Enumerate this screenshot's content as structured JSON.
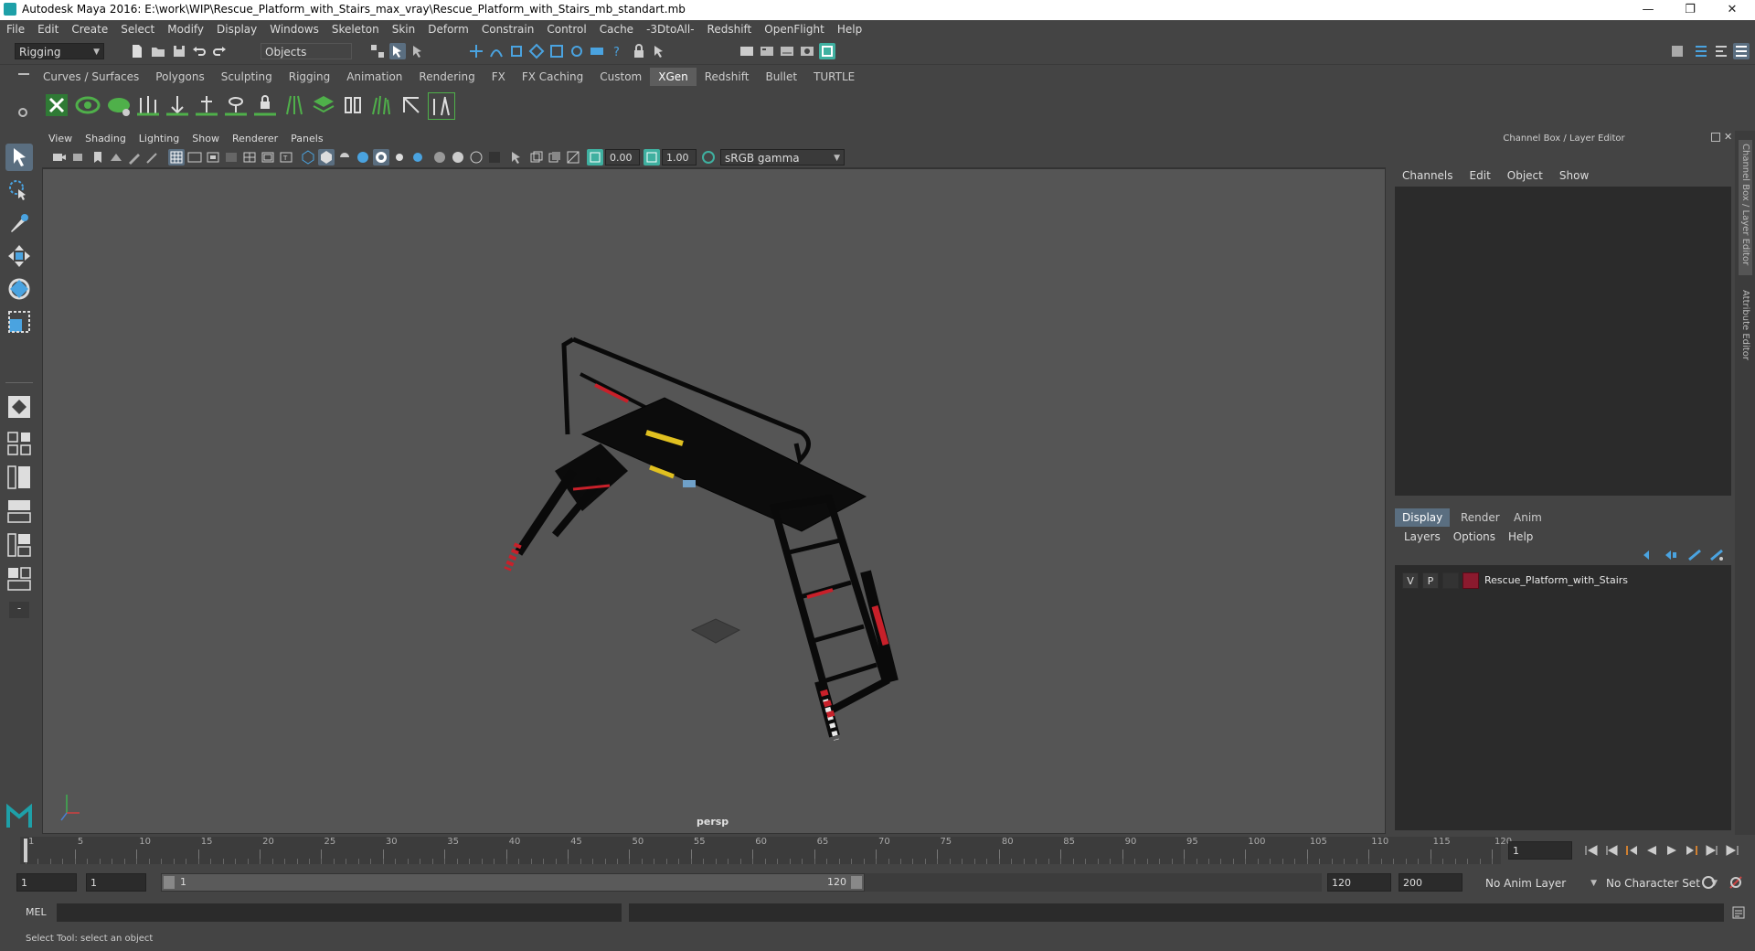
{
  "window": {
    "title": "Autodesk Maya 2016: E:\\work\\WIP\\Rescue_Platform_with_Stairs_max_vray\\Rescue_Platform_with_Stairs_mb_standart.mb",
    "minimize": "—",
    "maximize": "❐",
    "close": "✕"
  },
  "menubar": [
    "File",
    "Edit",
    "Create",
    "Select",
    "Modify",
    "Display",
    "Windows",
    "Skeleton",
    "Skin",
    "Deform",
    "Constrain",
    "Control",
    "Cache",
    "-3DtoAll-",
    "Redshift",
    "OpenFlight",
    "Help"
  ],
  "statusline": {
    "menuset": "Rigging",
    "selection_mode": "Objects"
  },
  "shelf": {
    "tabs": [
      "Curves / Surfaces",
      "Polygons",
      "Sculpting",
      "Rigging",
      "Animation",
      "Rendering",
      "FX",
      "FX Caching",
      "Custom",
      "XGen",
      "Redshift",
      "Bullet",
      "TURTLE"
    ],
    "active_tab": "XGen"
  },
  "viewport": {
    "menus": [
      "View",
      "Shading",
      "Lighting",
      "Show",
      "Renderer",
      "Panels"
    ],
    "exposure": "0.00",
    "gamma": "1.00",
    "color_space": "sRGB gamma",
    "camera_label": "persp"
  },
  "channel_box": {
    "title": "Channel Box / Layer Editor",
    "menus": [
      "Channels",
      "Edit",
      "Object",
      "Show"
    ]
  },
  "layer_editor": {
    "tabs": [
      "Display",
      "Render",
      "Anim"
    ],
    "active_tab": "Display",
    "menus": [
      "Layers",
      "Options",
      "Help"
    ],
    "layers": [
      {
        "v": "V",
        "p": "P",
        "color": "#8b1a2e",
        "name": "Rescue_Platform_with_Stairs"
      }
    ]
  },
  "side_tabs": [
    "Channel Box / Layer Editor",
    "Attribute Editor"
  ],
  "timeline": {
    "ticks": [
      "1",
      "5",
      "10",
      "15",
      "20",
      "25",
      "30",
      "35",
      "40",
      "45",
      "50",
      "55",
      "60",
      "65",
      "70",
      "75",
      "80",
      "85",
      "90",
      "95",
      "100",
      "105",
      "110",
      "115",
      "120"
    ],
    "current_frame": "1"
  },
  "range": {
    "start": "1",
    "playback_start": "1",
    "slider_start": "1",
    "slider_end": "120",
    "playback_end": "120",
    "end": "200",
    "anim_layer": "No Anim Layer",
    "character_set": "No Character Set"
  },
  "command_line": {
    "label": "MEL"
  },
  "help_line": {
    "text": "Select Tool: select an object"
  },
  "colors": {
    "ui_bg": "#444444",
    "viewport_bg": "#555555",
    "field_bg": "#2b2b2b",
    "accent_blue": "#5a6e80",
    "shelf_green": "#4fb04a",
    "layer_color": "#8b1a2e"
  }
}
